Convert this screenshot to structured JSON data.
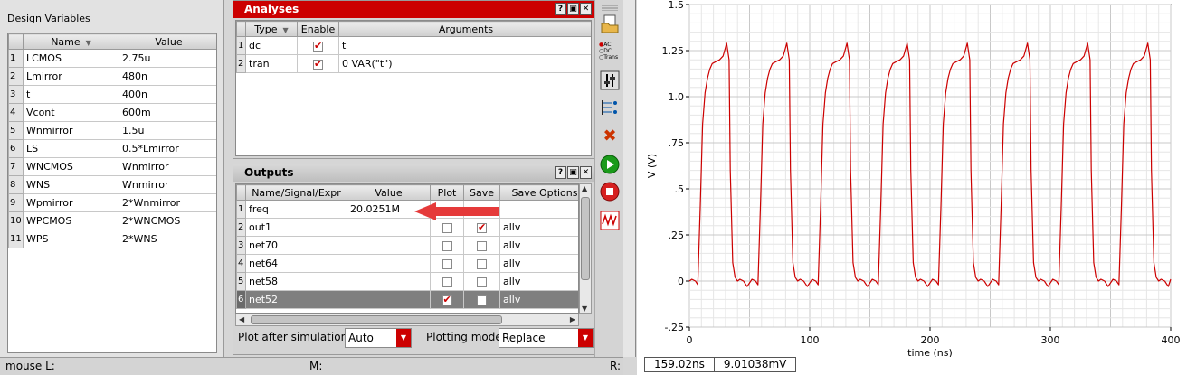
{
  "design_variables": {
    "title": "Design Variables",
    "columns": [
      "Name",
      "Value"
    ],
    "rows": [
      {
        "n": "1",
        "name": "LCMOS",
        "value": "2.75u"
      },
      {
        "n": "2",
        "name": "Lmirror",
        "value": "480n"
      },
      {
        "n": "3",
        "name": "t",
        "value": "400n"
      },
      {
        "n": "4",
        "name": "Vcont",
        "value": "600m"
      },
      {
        "n": "5",
        "name": "Wnmirror",
        "value": "1.5u"
      },
      {
        "n": "6",
        "name": "LS",
        "value": "0.5*Lmirror"
      },
      {
        "n": "7",
        "name": "WNCMOS",
        "value": "Wnmirror"
      },
      {
        "n": "8",
        "name": "WNS",
        "value": "Wnmirror"
      },
      {
        "n": "9",
        "name": "Wpmirror",
        "value": "2*Wnmirror"
      },
      {
        "n": "10",
        "name": "WPCMOS",
        "value": "2*WNCMOS"
      },
      {
        "n": "11",
        "name": "WPS",
        "value": "2*WNS"
      }
    ]
  },
  "analyses": {
    "title": "Analyses",
    "columns": [
      "Type",
      "Enable",
      "Arguments"
    ],
    "rows": [
      {
        "n": "1",
        "type": "dc",
        "enabled": true,
        "args": "t"
      },
      {
        "n": "2",
        "type": "tran",
        "enabled": true,
        "args": "0 VAR(\"t\")"
      }
    ]
  },
  "outputs": {
    "title": "Outputs",
    "columns": [
      "Name/Signal/Expr",
      "Value",
      "Plot",
      "Save",
      "Save Options"
    ],
    "rows": [
      {
        "n": "1",
        "name": "freq",
        "value": "20.0251M",
        "plot": null,
        "save": null,
        "opts": "",
        "selected": false
      },
      {
        "n": "2",
        "name": "out1",
        "value": "",
        "plot": false,
        "save": true,
        "opts": "allv",
        "selected": false
      },
      {
        "n": "3",
        "name": "net70",
        "value": "",
        "plot": false,
        "save": false,
        "opts": "allv",
        "selected": false
      },
      {
        "n": "4",
        "name": "net64",
        "value": "",
        "plot": false,
        "save": false,
        "opts": "allv",
        "selected": false
      },
      {
        "n": "5",
        "name": "net58",
        "value": "",
        "plot": false,
        "save": false,
        "opts": "allv",
        "selected": false
      },
      {
        "n": "6",
        "name": "net52",
        "value": "",
        "plot": true,
        "save": false,
        "opts": "allv",
        "selected": true
      }
    ],
    "plot_after_label": "Plot after simulation:",
    "plot_after_value": "Auto",
    "plotting_mode_label": "Plotting mode:",
    "plotting_mode_value": "Replace"
  },
  "toolbar": {
    "radio_options": [
      "AC",
      "DC",
      "Trans"
    ],
    "icons": [
      "scroll-icon",
      "open-folder-icon",
      "analysis-radio-icon",
      "tune-icon",
      "netlist-icon",
      "delete-icon",
      "run-icon",
      "stop-icon",
      "plot-icon"
    ]
  },
  "status": {
    "mouse": "mouse L:",
    "middle": "M:",
    "right": "R:"
  },
  "colors": {
    "accent": "#cc0000",
    "trace": "#cc0000",
    "selected_row": "#7f7f7f"
  },
  "chart_data": {
    "type": "line",
    "title": "",
    "xlabel": "time (ns)",
    "ylabel": "V (V)",
    "xlim": [
      0,
      400
    ],
    "ylim": [
      -0.25,
      1.5
    ],
    "x_ticks": [
      "0",
      "100",
      "200",
      "300",
      "400"
    ],
    "y_ticks": [
      "-.25",
      "0",
      ".25",
      ".5",
      ".75",
      "1.0",
      "1.25",
      "1.5"
    ],
    "grid": true,
    "series": [
      {
        "name": "",
        "period_ns": 50,
        "x": [
          0,
          2,
          5,
          7,
          9,
          11,
          13,
          15,
          17,
          19,
          22,
          25,
          28,
          31,
          33,
          34,
          36,
          38,
          40,
          42,
          45,
          48,
          52,
          55,
          57,
          59,
          61,
          63,
          65,
          67,
          69,
          72,
          75,
          78,
          81,
          83,
          84,
          86,
          88,
          90,
          92,
          95,
          98,
          102,
          105,
          107,
          109,
          111,
          113,
          115,
          117,
          119,
          122,
          125,
          128,
          131,
          133,
          134,
          136,
          138,
          140,
          142,
          145,
          148,
          152,
          155,
          157,
          159,
          161,
          163,
          165,
          167,
          169,
          172,
          175,
          178,
          181,
          183,
          184,
          186,
          188,
          190,
          192,
          195,
          198,
          202,
          205,
          207,
          209,
          211,
          213,
          215,
          217,
          219,
          222,
          225,
          228,
          231,
          233,
          234,
          236,
          238,
          240,
          242,
          245,
          248,
          252,
          255,
          257,
          259,
          261,
          263,
          265,
          267,
          269,
          272,
          275,
          278,
          281,
          283,
          284,
          286,
          288,
          290,
          292,
          295,
          298,
          302,
          305,
          307,
          309,
          311,
          313,
          315,
          317,
          319,
          322,
          325,
          328,
          331,
          333,
          334,
          336,
          338,
          340,
          342,
          345,
          348,
          352,
          355,
          357,
          359,
          361,
          363,
          365,
          367,
          369,
          372,
          375,
          378,
          381,
          383,
          384,
          386,
          388,
          390,
          392,
          395,
          398,
          400
        ],
        "y": [
          0.0,
          0.01,
          0.0,
          -0.02,
          0.4,
          0.85,
          1.02,
          1.1,
          1.15,
          1.18,
          1.19,
          1.2,
          1.22,
          1.29,
          1.2,
          0.6,
          0.1,
          0.02,
          0.0,
          0.01,
          0.0,
          -0.03,
          0.01,
          0.0,
          -0.02,
          0.4,
          0.85,
          1.02,
          1.1,
          1.15,
          1.18,
          1.19,
          1.2,
          1.22,
          1.29,
          1.2,
          0.6,
          0.1,
          0.02,
          0.0,
          0.01,
          0.0,
          -0.03,
          0.01,
          0.0,
          -0.02,
          0.4,
          0.85,
          1.02,
          1.1,
          1.15,
          1.18,
          1.19,
          1.2,
          1.22,
          1.29,
          1.2,
          0.6,
          0.1,
          0.02,
          0.0,
          0.01,
          0.0,
          -0.03,
          0.01,
          0.0,
          -0.02,
          0.4,
          0.85,
          1.02,
          1.1,
          1.15,
          1.18,
          1.19,
          1.2,
          1.22,
          1.29,
          1.2,
          0.6,
          0.1,
          0.02,
          0.0,
          0.01,
          0.0,
          -0.03,
          0.01,
          0.0,
          -0.02,
          0.4,
          0.85,
          1.02,
          1.1,
          1.15,
          1.18,
          1.19,
          1.2,
          1.22,
          1.29,
          1.2,
          0.6,
          0.1,
          0.02,
          0.0,
          0.01,
          0.0,
          -0.03,
          0.01,
          0.0,
          -0.02,
          0.4,
          0.85,
          1.02,
          1.1,
          1.15,
          1.18,
          1.19,
          1.2,
          1.22,
          1.29,
          1.2,
          0.6,
          0.1,
          0.02,
          0.0,
          0.01,
          0.0,
          -0.03,
          0.01,
          0.0,
          -0.02,
          0.4,
          0.85,
          1.02,
          1.1,
          1.15,
          1.18,
          1.19,
          1.2,
          1.22,
          1.29,
          1.2,
          0.6,
          0.1,
          0.02,
          0.0,
          0.01,
          0.0,
          -0.03,
          0.01,
          0.0,
          -0.02,
          0.4,
          0.85,
          1.02,
          1.1,
          1.15,
          1.18,
          1.19,
          1.2,
          1.22,
          1.29,
          1.2,
          0.6,
          0.1,
          0.02,
          0.0,
          0.01,
          0.0,
          -0.03,
          0.01
        ]
      }
    ],
    "cursor_readout": [
      "159.02ns",
      "9.01038mV"
    ]
  }
}
